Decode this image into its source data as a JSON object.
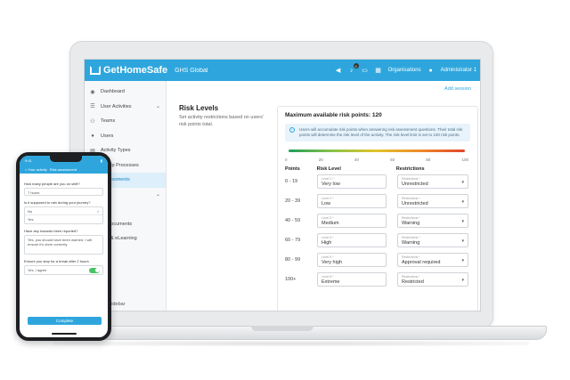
{
  "header": {
    "brand": "GetHomeSafe",
    "org": "GHS Global",
    "notif_count": "0",
    "organisations": "Organisations",
    "user": "Administrator 1"
  },
  "sidebar": {
    "items": [
      {
        "label": "Dashboard",
        "icon": "dashboard-icon"
      },
      {
        "label": "User Activities",
        "icon": "users-icon"
      },
      {
        "label": "Teams",
        "icon": "teams-icon"
      },
      {
        "label": "Users",
        "icon": "user-icon"
      },
      {
        "label": "Activity Types",
        "icon": "activity-icon"
      },
      {
        "label": "ow Up Processes",
        "icon": "process-icon"
      },
      {
        "label": "Assessments",
        "icon": "assessment-icon"
      },
      {
        "label": "s",
        "icon": "settings-icon"
      },
      {
        "label": "orts",
        "icon": "reports-icon"
      },
      {
        "label": "ny Documents",
        "icon": "documents-icon"
      },
      {
        "label": "port & eLearning",
        "icon": "support-icon"
      }
    ],
    "collapse": "apse sidebar"
  },
  "main": {
    "add_session": "Add session",
    "title": "Risk Levels",
    "description": "Set activity restrictions based on users' risk points total.",
    "max_points": "Maximum available risk points: 120",
    "info": "Users will accumulate risk points when answering risk assessment questions. Their total risk points will determine the risk level of the activity. The risk level limit is set to 100 risk points.",
    "scale": [
      "0",
      "20",
      "40",
      "60",
      "80",
      "100"
    ],
    "col_points": "Points",
    "col_level": "Risk Level",
    "col_restr": "Restrictions",
    "level_field_prefix": "Level",
    "restr_field_label": "Restrictions *",
    "rows": [
      {
        "points": "0 - 19",
        "level_label": "Level 1 *",
        "level": "Very low",
        "restr": "Unrestricted"
      },
      {
        "points": "20 - 39",
        "level_label": "Level 2 *",
        "level": "Low",
        "restr": "Unrestricted"
      },
      {
        "points": "40 - 59",
        "level_label": "Level 3 *",
        "level": "Medium",
        "restr": "Warning"
      },
      {
        "points": "60 - 79",
        "level_label": "Level 4 *",
        "level": "High",
        "restr": "Warning"
      },
      {
        "points": "80 - 99",
        "level_label": "Level 5 *",
        "level": "Very high",
        "restr": "Approval required"
      },
      {
        "points": "100+",
        "level_label": "Level 6 *",
        "level": "Extreme",
        "restr": "Restricted"
      }
    ]
  },
  "phone": {
    "time": "9:41",
    "nav_back": "< Your activity",
    "nav_title": "Risk assessment",
    "q1": "How many people are you on shift?",
    "a1": "7 hours",
    "q2": "Is it supposed to rain during your journey?",
    "opt_no": "No",
    "opt_yes": "Yes",
    "q3": "Have any hazards been reported?",
    "a3": "Yes, you should have been warned. I will ensure it's done correctly.",
    "q4": "Ensure you stop for a break after 2 hours",
    "toggle_label": "Yes, I agree",
    "complete": "Complete"
  }
}
